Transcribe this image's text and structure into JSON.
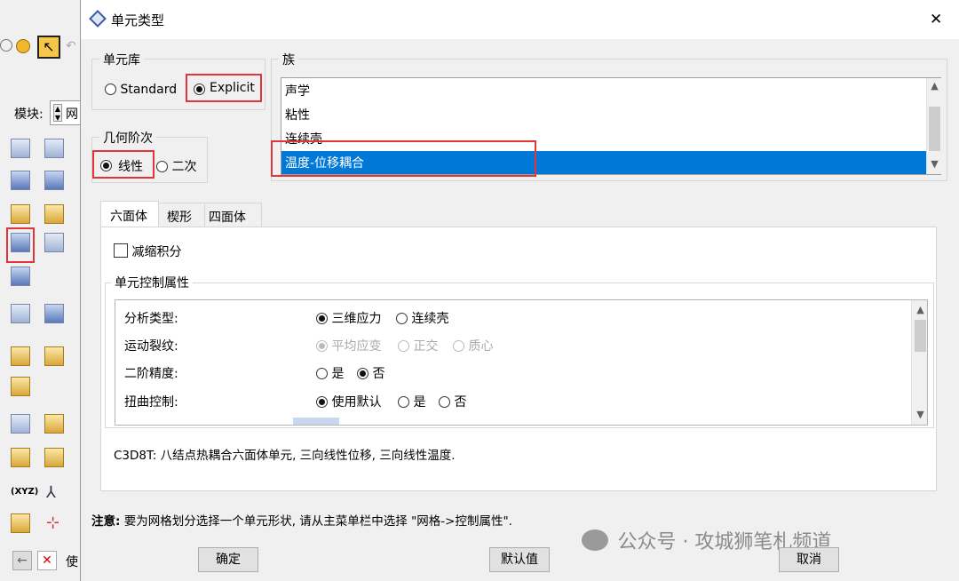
{
  "app": {
    "module_label": "模块:",
    "module_value": "网",
    "bottom_label": "使"
  },
  "dialog": {
    "title": "单元类型",
    "close_glyph": "✕",
    "element_library": {
      "legend": "单元库",
      "options": [
        "Standard",
        "Explicit"
      ],
      "selected": "Explicit"
    },
    "geometric_order": {
      "legend": "几何阶次",
      "options": [
        "线性",
        "二次"
      ],
      "selected": "线性"
    },
    "family": {
      "legend": "族",
      "items": [
        "声学",
        "粘性",
        "连续壳",
        "温度-位移耦合"
      ],
      "selected": "温度-位移耦合"
    },
    "tabs": [
      "六面体",
      "楔形",
      "四面体"
    ],
    "active_tab": "六面体",
    "reduced_integration": {
      "label": "减缩积分",
      "checked": false
    },
    "controls": {
      "legend": "单元控制属性",
      "rows": [
        {
          "label": "分析类型:",
          "options": [
            "三维应力",
            "连续壳"
          ],
          "selected": "三维应力",
          "enabled": true
        },
        {
          "label": "运动裂纹:",
          "options": [
            "平均应变",
            "正交",
            "质心"
          ],
          "selected": "平均应变",
          "enabled": false
        },
        {
          "label": "二阶精度:",
          "options": [
            "是",
            "否"
          ],
          "selected": "否",
          "enabled": true
        },
        {
          "label": "扭曲控制:",
          "options": [
            "使用默认",
            "是",
            "否"
          ],
          "selected": "使用默认",
          "enabled": true
        }
      ]
    },
    "description": "C3D8T:  八结点热耦合六面体单元, 三向线性位移, 三向线性温度.",
    "note_label": "注意:",
    "note_text": "要为网格划分选择一个单元形状, 请从主菜单栏中选择 \"网格->控制属性\".",
    "buttons": {
      "ok": "确定",
      "defaults": "默认值",
      "cancel": "取消"
    },
    "watermark": "公众号 · 攻城狮笔札频道"
  },
  "colors": {
    "selection": "#0078d7",
    "highlight_border": "#e0353a"
  }
}
